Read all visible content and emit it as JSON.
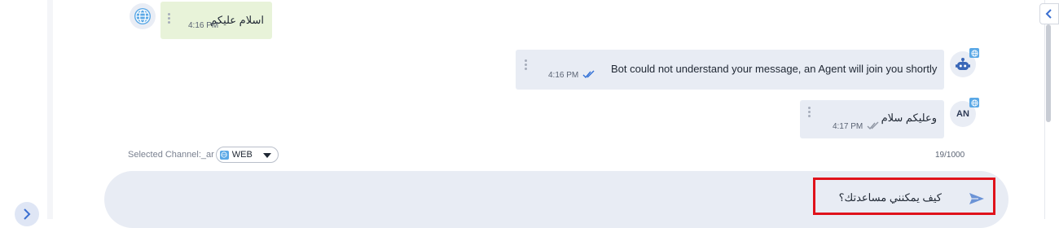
{
  "messages": [
    {
      "sender": "visitor",
      "avatar_icon": "globe-icon",
      "text": "اسلام عليكم",
      "time": "4:16 PM"
    },
    {
      "sender": "bot",
      "avatar_icon": "robot-icon",
      "badge_icon": "web-channel-icon",
      "text": "Bot could not understand your message, an Agent will join you shortly",
      "time": "4:16 PM",
      "status_icon": "double-check-icon"
    },
    {
      "sender": "agent",
      "avatar_label": "AN",
      "badge_icon": "web-channel-icon",
      "text": "وعليكم سلام",
      "time": "4:17 PM",
      "status_icon": "double-check-icon"
    }
  ],
  "composer": {
    "channel_label": "Selected Channel:_ar",
    "channel_value": "WEB",
    "char_count": "19/1000",
    "input_text": "كيف يمكنني مساعدتك؟"
  },
  "colors": {
    "visitor_bubble": "#e8f3d9",
    "agent_bubble": "#e8ecf4",
    "accent": "#5aa8e6",
    "highlight": "#e0121b"
  }
}
